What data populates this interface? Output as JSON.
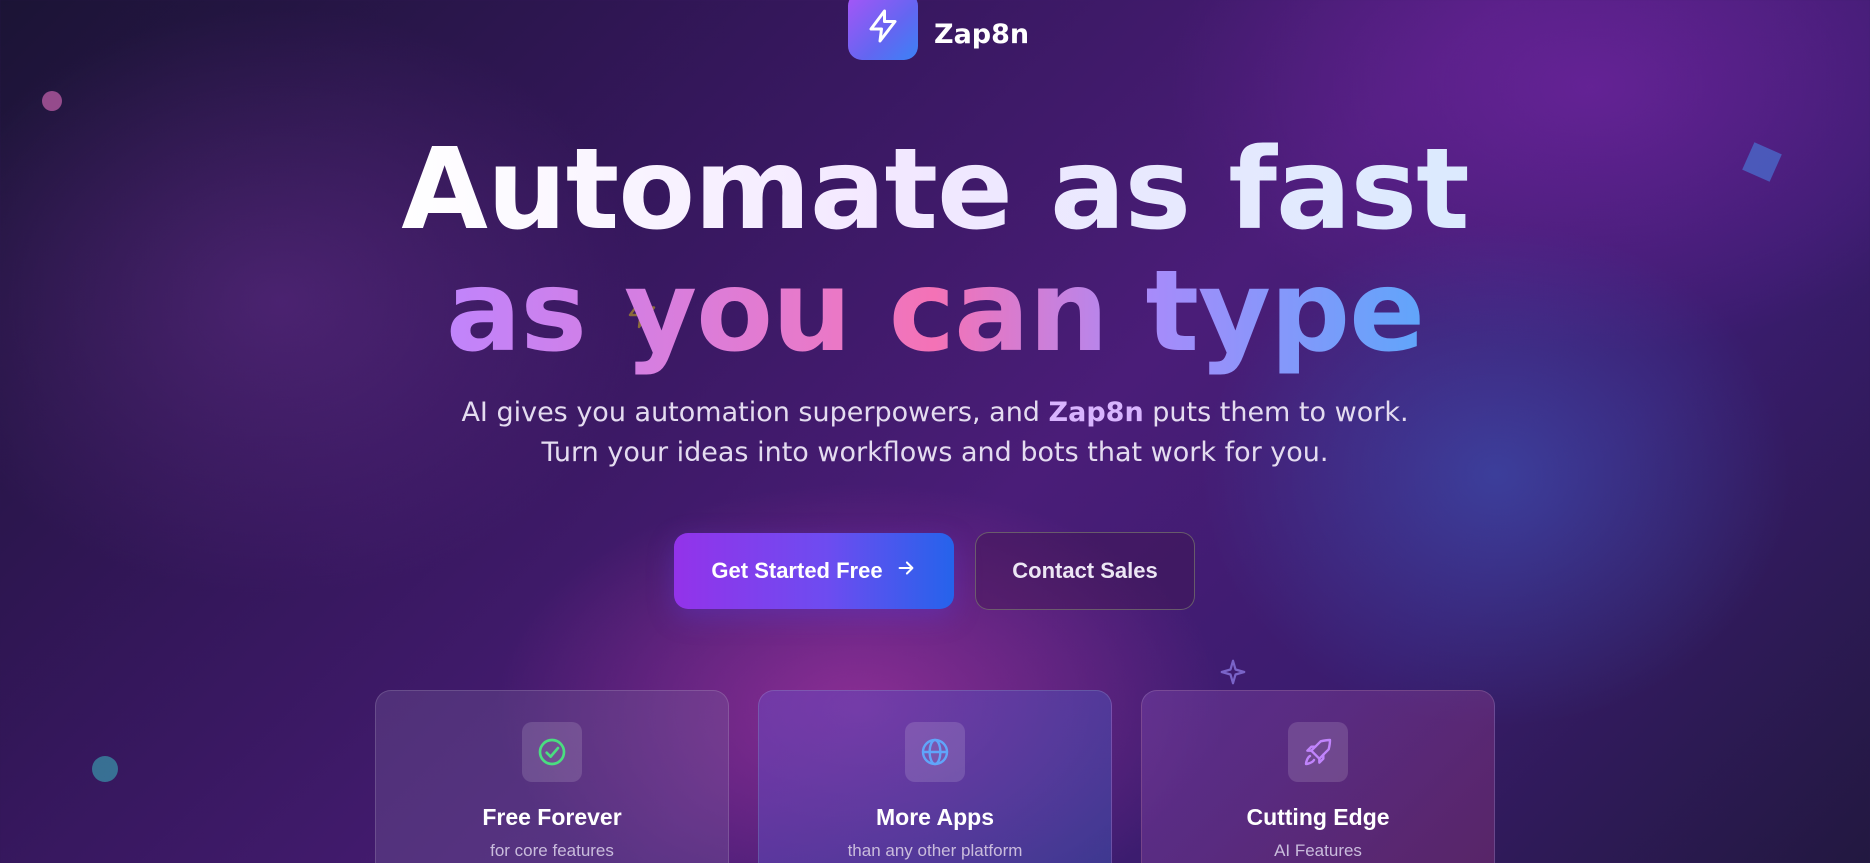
{
  "brand": {
    "name": "Zap8n",
    "logo_icon": "lightning-bolt-icon"
  },
  "hero": {
    "headline_line1": "Automate as fast",
    "headline_line2": "as you can type",
    "subtitle_pre": "AI gives you automation superpowers, and ",
    "subtitle_brand": "Zap8n",
    "subtitle_post": " puts them to work.",
    "subtitle_line2": "Turn your ideas into workflows and bots that work for you."
  },
  "actions": {
    "primary_label": "Get Started Free",
    "primary_icon": "arrow-right-icon",
    "secondary_label": "Contact Sales"
  },
  "features": [
    {
      "title": "Free Forever",
      "subtitle": "for core features",
      "icon": "check-circle-icon",
      "icon_color": "#4ade80"
    },
    {
      "title": "More Apps",
      "subtitle": "than any other platform",
      "icon": "globe-icon",
      "icon_color": "#60a5fa"
    },
    {
      "title": "Cutting Edge",
      "subtitle": "AI Features",
      "icon": "rocket-icon",
      "icon_color": "#c084fc"
    }
  ],
  "colors": {
    "accent_purple": "#9333ea",
    "accent_blue": "#2563eb",
    "highlight": "#d8b4fe"
  }
}
